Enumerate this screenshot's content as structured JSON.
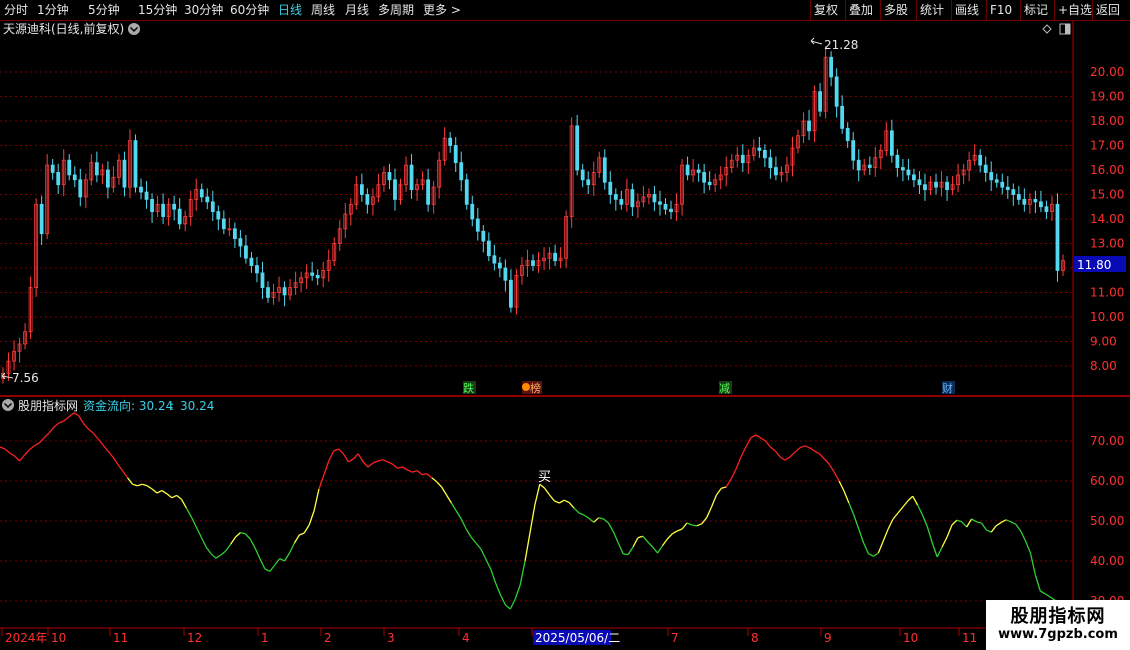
{
  "toolbar": {
    "left": [
      {
        "label": "分时",
        "active": false
      },
      {
        "label": "1分钟",
        "active": false
      },
      {
        "label": "5分钟",
        "active": false
      },
      {
        "label": "15分钟",
        "active": false
      },
      {
        "label": "30分钟",
        "active": false
      },
      {
        "label": "60分钟",
        "active": false
      },
      {
        "label": "日线",
        "active": true
      },
      {
        "label": "周线",
        "active": false
      },
      {
        "label": "月线",
        "active": false
      },
      {
        "label": "多周期",
        "active": false
      },
      {
        "label": "更多 >",
        "active": false
      }
    ],
    "right": [
      "复权",
      "叠加",
      "多股",
      "统计",
      "画线",
      "F10",
      "标记",
      "+自选",
      "返回"
    ]
  },
  "main_panel": {
    "title": "天源迪科(日线,前复权)",
    "price_ticks": [
      "20.00",
      "19.00",
      "18.00",
      "17.00",
      "16.00",
      "15.00",
      "14.00",
      "13.00",
      "12.00",
      "11.00",
      "10.00",
      "9.00",
      "8.00"
    ],
    "last_price": "11.80",
    "high_label": "21.28",
    "low_label": "7.56",
    "event_tags": [
      "跌",
      "榜",
      "减",
      "财"
    ]
  },
  "indicator_panel": {
    "name": "股朋指标网",
    "line_label": "资金流向: 30.24",
    "line_value": "30.24",
    "ticks": [
      "70.00",
      "60.00",
      "50.00",
      "40.00",
      "30.00"
    ],
    "buy_signal": "买"
  },
  "time_axis": {
    "labels": [
      "2024年",
      "10",
      "11",
      "12",
      "1",
      "2",
      "3",
      "4",
      "2025/05/06/二",
      "7",
      "8",
      "9",
      "10",
      "11"
    ]
  },
  "watermark": {
    "line1": "股朋指标网",
    "line2": "www.7gpzb.com"
  },
  "colors": {
    "up": "#ff3c3c",
    "down": "#54d8f0",
    "grid": "#7a0000",
    "axis": "#b00000",
    "line_red": "#ff2020",
    "line_yellow": "#ffff40",
    "line_green": "#30d030",
    "text_cyan": "#39d0e8"
  },
  "chart_data": {
    "type": "candlestick",
    "price_range": [
      7.56,
      21.28
    ],
    "candles_close": [
      7.7,
      8.2,
      8.6,
      8.9,
      9.4,
      11.2,
      14.6,
      13.4,
      16.2,
      15.9,
      15.4,
      16.4,
      15.8,
      15.6,
      14.9,
      15.6,
      16.3,
      15.8,
      16.0,
      15.3,
      15.7,
      16.4,
      15.3,
      17.2,
      15.3,
      15.1,
      14.8,
      14.3,
      14.6,
      14.1,
      14.6,
      14.4,
      13.8,
      14.1,
      14.8,
      15.2,
      14.9,
      14.7,
      14.3,
      14.0,
      13.6,
      13.6,
      13.2,
      12.9,
      12.4,
      12.1,
      11.8,
      11.2,
      10.8,
      11.0,
      11.2,
      10.9,
      11.2,
      11.4,
      11.6,
      11.8,
      11.7,
      11.6,
      11.9,
      12.3,
      13.0,
      13.6,
      14.2,
      14.6,
      15.4,
      15.0,
      14.6,
      14.9,
      15.4,
      15.9,
      15.6,
      14.8,
      15.4,
      16.2,
      15.2,
      15.4,
      15.6,
      14.6,
      15.3,
      16.4,
      17.3,
      17.0,
      16.3,
      15.6,
      14.6,
      14.0,
      13.5,
      13.1,
      12.5,
      12.2,
      12.0,
      11.5,
      10.4,
      11.7,
      12.1,
      12.3,
      12.1,
      12.3,
      12.4,
      12.6,
      12.3,
      12.4,
      14.1,
      17.8,
      16.0,
      15.6,
      15.4,
      15.9,
      16.5,
      15.5,
      15.0,
      14.8,
      14.6,
      15.2,
      14.5,
      14.7,
      14.9,
      15.0,
      14.7,
      14.6,
      14.4,
      14.3,
      14.6,
      16.2,
      15.8,
      16.0,
      15.9,
      15.5,
      15.4,
      15.6,
      15.8,
      16.1,
      16.4,
      16.6,
      16.3,
      16.6,
      16.9,
      16.8,
      16.5,
      16.1,
      15.8,
      15.9,
      16.2,
      16.9,
      17.4,
      18.0,
      17.6,
      19.2,
      18.4,
      20.6,
      19.8,
      18.6,
      17.7,
      17.2,
      16.4,
      16.0,
      16.2,
      16.1,
      16.5,
      16.8,
      17.6,
      16.6,
      16.1,
      16.0,
      15.8,
      15.6,
      15.4,
      15.2,
      15.5,
      15.3,
      15.5,
      15.2,
      15.4,
      15.8,
      16.0,
      16.4,
      16.6,
      16.2,
      15.9,
      15.6,
      15.5,
      15.3,
      15.2,
      15.0,
      14.8,
      14.6,
      14.8,
      14.7,
      14.5,
      14.3,
      14.6,
      11.9,
      12.3
    ],
    "indicator_range": [
      30,
      80
    ],
    "indicator_values": [
      68.5,
      68.0,
      67.0,
      66.2,
      65.0,
      66.5,
      67.8,
      68.8,
      69.5,
      70.8,
      72.0,
      73.5,
      74.5,
      75.0,
      76.0,
      77.0,
      76.4,
      74.4,
      73.0,
      72.0,
      70.5,
      69.0,
      67.5,
      66.0,
      64.2,
      62.5,
      60.8,
      59.2,
      58.8,
      59.2,
      58.8,
      58.0,
      57.0,
      57.6,
      56.8,
      55.8,
      56.4,
      55.4,
      53.2,
      51.0,
      48.5,
      46.0,
      43.5,
      41.8,
      40.7,
      41.5,
      42.5,
      44.2,
      46.0,
      47.1,
      46.8,
      45.5,
      43.2,
      40.5,
      38.0,
      37.4,
      39.0,
      40.6,
      40.0,
      42.0,
      44.5,
      46.5,
      47.0,
      49.0,
      52.5,
      58.0,
      61.5,
      65.0,
      67.5,
      68.0,
      66.8,
      64.8,
      65.5,
      66.8,
      64.8,
      63.5,
      64.5,
      65.0,
      65.3,
      64.8,
      64.2,
      63.2,
      63.5,
      62.8,
      62.2,
      62.6,
      61.6,
      61.8,
      60.8,
      59.8,
      58.5,
      56.5,
      54.5,
      52.5,
      50.5,
      48.0,
      46.0,
      44.5,
      43.0,
      40.5,
      38.0,
      34.5,
      31.5,
      29.0,
      28.0,
      30.5,
      34.0,
      40.0,
      47.0,
      54.0,
      59.2,
      58.2,
      56.5,
      55.0,
      54.5,
      55.2,
      54.6,
      53.2,
      52.0,
      51.5,
      50.7,
      49.7,
      50.8,
      50.5,
      49.5,
      47.3,
      44.5,
      41.8,
      41.6,
      43.5,
      45.8,
      46.2,
      44.8,
      43.5,
      42.0,
      43.8,
      45.5,
      46.8,
      47.5,
      48.0,
      49.5,
      49.0,
      48.8,
      49.3,
      50.8,
      53.5,
      56.5,
      58.2,
      58.5,
      60.5,
      63.0,
      66.0,
      68.5,
      70.8,
      71.5,
      70.8,
      70.0,
      68.5,
      67.5,
      66.0,
      65.2,
      66.0,
      67.2,
      68.3,
      68.8,
      68.3,
      67.5,
      66.8,
      65.5,
      64.2,
      62.2,
      60.0,
      57.5,
      54.5,
      51.5,
      48.0,
      44.5,
      41.8,
      41.2,
      42.0,
      45.0,
      48.0,
      50.5,
      52.0,
      53.5,
      55.0,
      56.2,
      54.0,
      51.5,
      48.5,
      44.5,
      41.0,
      43.5,
      46.0,
      49.0,
      50.2,
      49.8,
      48.5,
      50.5,
      49.8,
      49.5,
      47.8,
      47.2,
      48.8,
      49.6,
      50.3,
      49.8,
      49.2,
      47.5,
      45.0,
      42.0,
      36.5,
      32.5,
      31.8,
      31.0,
      30.2
    ]
  }
}
